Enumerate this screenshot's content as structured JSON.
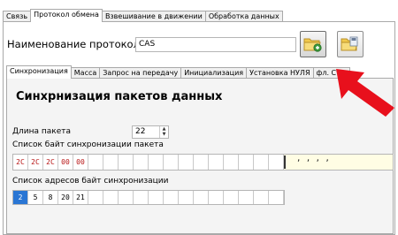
{
  "top_tabs": [
    "Связь",
    "Протокол обмена",
    "Взвешивание в движении",
    "Обработка данных"
  ],
  "top_tabs_active": 1,
  "protocol": {
    "label": "Наименование протокола",
    "value": "CAS"
  },
  "toolbar": {
    "open_icon": "folder-open-icon",
    "save_icon": "folder-save-icon"
  },
  "sub_tabs": [
    "Синхронизация",
    "Масса",
    "Запрос на передачу",
    "Инициализация",
    "Установка НУЛЯ",
    "фл. Ст..."
  ],
  "sub_tabs_active": 0,
  "section": {
    "title": "Синхрнизация пакетов данных"
  },
  "packet_length": {
    "label": "Длина пакета",
    "value": "22"
  },
  "sync_bytes": {
    "label": "Список байт синхронизации пакета",
    "bytes": [
      "2C",
      "2C",
      "2C",
      "00",
      "00",
      "",
      "",
      "",
      "",
      "",
      "",
      "",
      "",
      "",
      "",
      "",
      "",
      ""
    ],
    "ascii": ", , , ,"
  },
  "sync_addresses": {
    "label": "Список адресов байт синхронизации",
    "addresses": [
      "2",
      "5",
      "8",
      "20",
      "21",
      "",
      "",
      "",
      "",
      "",
      "",
      "",
      "",
      "",
      "",
      "",
      "",
      ""
    ],
    "selected_index": 0
  },
  "colors": {
    "byte_text": "#b81414",
    "ascii_bg": "#fffde4",
    "selection": "#2a76d4",
    "arrow": "#e8101c"
  }
}
